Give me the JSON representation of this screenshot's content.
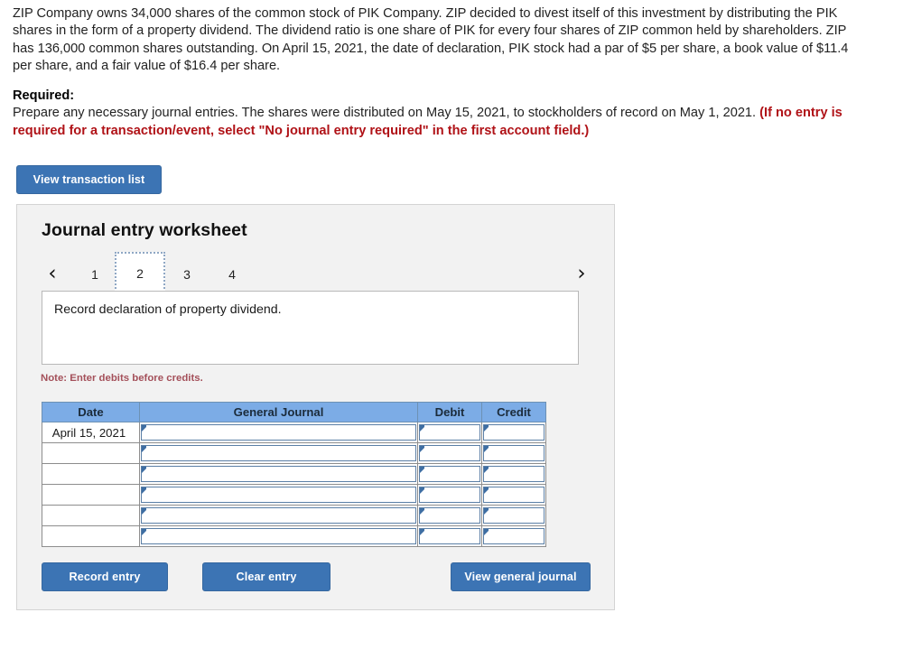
{
  "problem": {
    "statement": "ZIP Company owns 34,000 shares of the common stock of PIK Company. ZIP decided to divest itself of this investment by distributing the PIK shares in the form of a property dividend. The dividend ratio is one share of PIK for every four shares of ZIP common held by shareholders. ZIP has 136,000 common shares outstanding. On April 15, 2021, the date of declaration, PIK stock had a par of $5 per share, a book value of $11.4 per share, and a fair value of $16.4 per share."
  },
  "required": {
    "label": "Required:",
    "text": "Prepare any necessary journal entries. The shares were distributed on May 15, 2021, to stockholders of record on May 1, 2021. ",
    "warning": "(If no entry is required for a transaction/event, select \"No journal entry required\" in the first account field.)"
  },
  "toolbar": {
    "view_transaction_list_label": "View transaction list"
  },
  "worksheet": {
    "title": "Journal entry worksheet",
    "pager": {
      "prev_icon": "‹",
      "next_icon": "›",
      "tabs": [
        {
          "label": "1",
          "active": false
        },
        {
          "label": "2",
          "active": true
        },
        {
          "label": "3",
          "active": false
        },
        {
          "label": "4",
          "active": false
        }
      ]
    },
    "entry_description": "Record declaration of property dividend.",
    "note": "Note: Enter debits before credits.",
    "table": {
      "columns": [
        "Date",
        "General Journal",
        "Debit",
        "Credit"
      ],
      "rows": [
        {
          "date": "April 15, 2021",
          "general_journal": "",
          "debit": "",
          "credit": ""
        },
        {
          "date": "",
          "general_journal": "",
          "debit": "",
          "credit": ""
        },
        {
          "date": "",
          "general_journal": "",
          "debit": "",
          "credit": ""
        },
        {
          "date": "",
          "general_journal": "",
          "debit": "",
          "credit": ""
        },
        {
          "date": "",
          "general_journal": "",
          "debit": "",
          "credit": ""
        },
        {
          "date": "",
          "general_journal": "",
          "debit": "",
          "credit": ""
        }
      ]
    },
    "buttons": {
      "record_entry": "Record entry",
      "clear_entry": "Clear entry",
      "view_general_journal": "View general journal"
    }
  },
  "colors": {
    "button_blue": "#3c74b4",
    "header_blue": "#7cace6",
    "panel_bg": "#f2f2f2",
    "warning_red": "#b01217",
    "note_red": "#a4505a"
  }
}
